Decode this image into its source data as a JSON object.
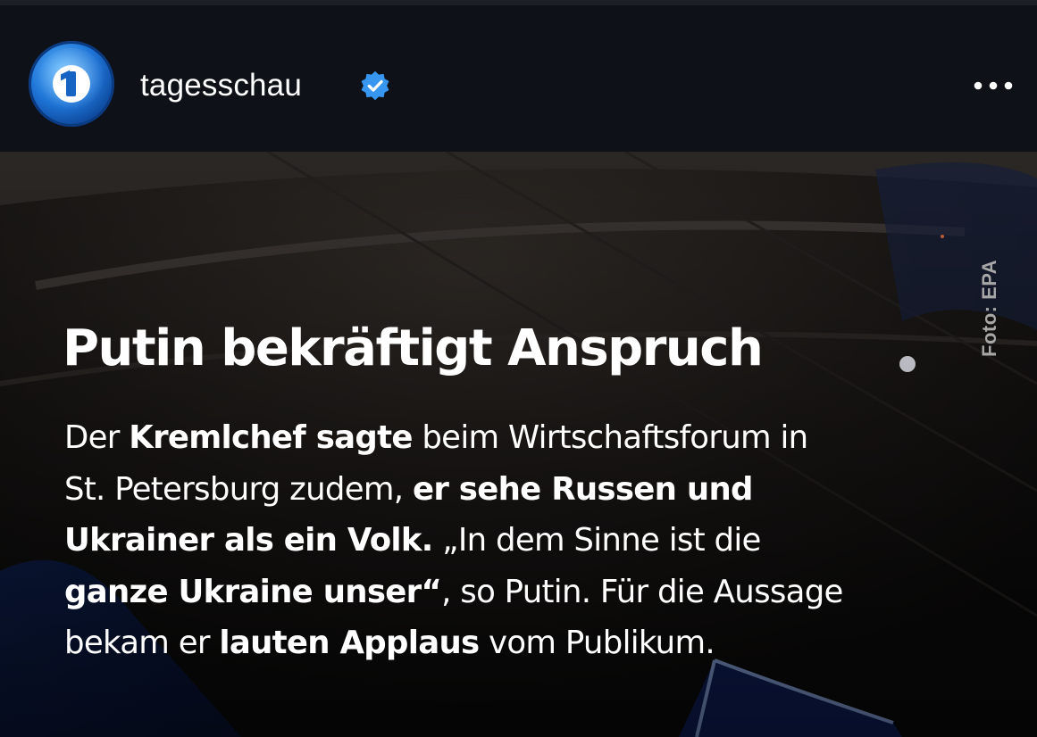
{
  "header": {
    "account_name": "tagesschau",
    "verified": true,
    "avatar_icon": "ard-das-erste-logo",
    "more_icon": "more-horizontal-icon"
  },
  "post": {
    "photo_credit": "Foto: EPA",
    "headline": "Putin bekräftigt Anspruch",
    "body_lines": [
      [
        {
          "text": "Der ",
          "bold": false
        },
        {
          "text": "Kremlchef sagte",
          "bold": true
        },
        {
          "text": " beim Wirtschaftsforum in",
          "bold": false
        }
      ],
      [
        {
          "text": "St. Petersburg zudem, ",
          "bold": false
        },
        {
          "text": "er sehe Russen und",
          "bold": true
        }
      ],
      [
        {
          "text": "Ukrainer als ein Volk.",
          "bold": true
        },
        {
          "text": " „In dem Sinne ist die",
          "bold": false
        }
      ],
      [
        {
          "text": "ganze Ukraine unser“",
          "bold": true
        },
        {
          "text": ", so Putin. Für die Aussage",
          "bold": false
        }
      ],
      [
        {
          "text": "bekam er ",
          "bold": false
        },
        {
          "text": "lauten Applaus",
          "bold": true
        },
        {
          "text": " vom Publikum.",
          "bold": false
        }
      ]
    ]
  },
  "colors": {
    "header_bg": "#0e1117",
    "verified_blue": "#3797f0",
    "text": "#ffffff",
    "credit": "#a7a7a7"
  }
}
